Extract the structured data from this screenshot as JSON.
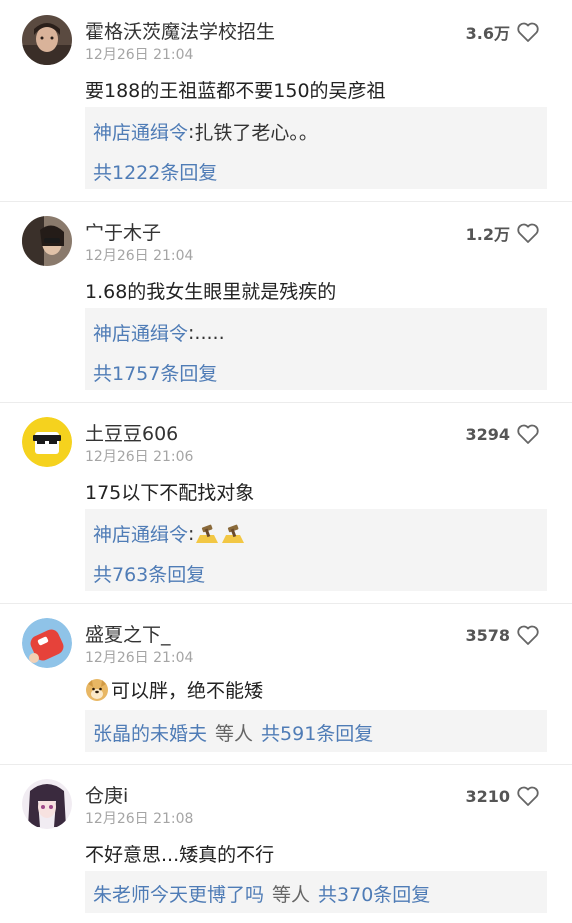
{
  "comments": [
    {
      "username": "霍格沃茨魔法学校招生",
      "time": "12月26日 21:04",
      "likes": "3.6万",
      "content": "要188的王祖蓝都不要150的吴彦祖",
      "reply_author": "神店通缉令",
      "reply_sep": ":",
      "reply_text": "扎铁了老心。。",
      "reply_count": "共1222条回复"
    },
    {
      "username": "宀于木子",
      "time": "12月26日 21:04",
      "likes": "1.2万",
      "content": "1.68的我女生眼里就是残疾的",
      "reply_author": "神店通缉令",
      "reply_sep": ":",
      "reply_text": ".....",
      "reply_count": "共1757条回复"
    },
    {
      "username": "土豆豆606",
      "time": "12月26日 21:06",
      "likes": "3294",
      "content": "175以下不配找对象",
      "reply_author": "神店通缉令",
      "reply_sep": ":",
      "reply_emojis": [
        "gavel-emoji",
        "gavel-emoji"
      ],
      "reply_count": "共763条回复"
    },
    {
      "username": "盛夏之下_",
      "time": "12月26日 21:04",
      "likes": "3578",
      "content_emoji": "doge-emoji",
      "content": "可以胖，绝不能矮",
      "reply_author": "张晶的未婚夫",
      "reply_others": "等人",
      "reply_count": "共591条回复"
    },
    {
      "username": "仓庚i",
      "time": "12月26日 21:08",
      "likes": "3210",
      "content": "不好意思...矮真的不行",
      "reply_author": "朱老师今天更博了吗",
      "reply_others": "等人",
      "reply_count": "共370条回复"
    }
  ],
  "icons": {
    "like": "heart-outline-icon"
  },
  "colors": {
    "link_blue": "#4f7cb6",
    "reply_bg": "#f4f4f4",
    "time_gray": "#a5a5a5"
  }
}
